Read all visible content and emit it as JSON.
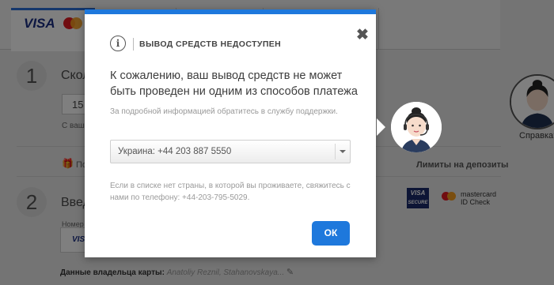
{
  "background": {
    "step1_number": "1",
    "step1_label": "Сколь",
    "amount_value": "15",
    "amount_hint": "С ваш",
    "gift_label": "По",
    "deposit_limits": "Лимиты на депозиты",
    "step2_number": "2",
    "step2_label": "Введ",
    "card_number_label": "Номер",
    "visa_label": "VISA",
    "visa_secure_label": "VISA",
    "visa_secure_sub": "SECURE",
    "mastercard_label": "mastercard",
    "mastercard_sub": "ID Check",
    "cardholder_label": "Данные владельца карты:",
    "cardholder_value": "Anatoliy Reznil, Stahanovskaya...",
    "help_label": "Справка?"
  },
  "modal": {
    "title": "ВЫВОД СРЕДСТВ НЕДОСТУПЕН",
    "message": "К сожалению, ваш вывод средств не может быть проведен ни одним из способов платежа",
    "note": "За подробной информацией обратитесь в службу поддержки.",
    "phone_selected": "Украина: +44 203 887 5550",
    "footer_note": "Если в списке нет страны, в которой вы проживаете, свяжитесь с нами по телефону: +44-203-795-5029.",
    "ok_label": "ОК",
    "close_label": "✖",
    "info_glyph": "i"
  },
  "colors": {
    "accent": "#1e78dc",
    "overlay": "rgba(0,0,0,0.5)"
  },
  "icons": [
    "info-icon",
    "close-icon",
    "chevron-down-icon",
    "support-agent-icon",
    "gift-icon",
    "pencil-icon"
  ]
}
